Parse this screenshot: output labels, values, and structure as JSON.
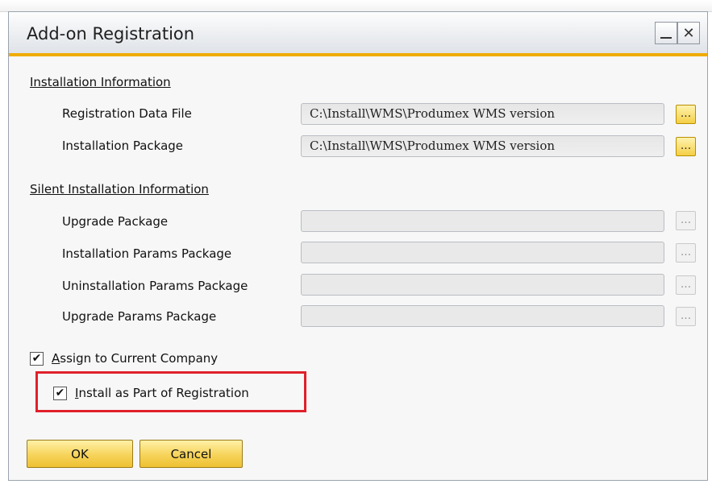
{
  "window": {
    "title": "Add-on Registration",
    "minimize_glyph": "_",
    "close_glyph": "✕"
  },
  "installation_info": {
    "section_title": "Installation Information",
    "rows": [
      {
        "label": "Registration Data File",
        "value": "C:\\Install\\WMS\\Produmex WMS version",
        "browse": "..."
      },
      {
        "label": "Installation Package",
        "value": "C:\\Install\\WMS\\Produmex WMS version",
        "browse": "..."
      }
    ]
  },
  "silent_installation": {
    "section_title": "Silent Installation Information",
    "rows": [
      {
        "label": "Upgrade Package",
        "value": "",
        "browse": "..."
      },
      {
        "label": "Installation Params Package",
        "value": "",
        "browse": "..."
      },
      {
        "label": "Uninstallation Params Package",
        "value": "",
        "browse": "..."
      },
      {
        "label": "Upgrade Params Package",
        "value": "",
        "browse": "..."
      }
    ]
  },
  "options": {
    "assign_to_company": {
      "label_hotkey": "A",
      "label_rest": "ssign to Current Company",
      "checked": true,
      "mark": "✔"
    },
    "install_as_part": {
      "label_hotkey": "I",
      "label_rest": "nstall as Part of Registration",
      "checked": true,
      "mark": "✔"
    }
  },
  "buttons": {
    "ok": "OK",
    "cancel": "Cancel"
  },
  "colors": {
    "accent": "#f0ab00",
    "highlight_border": "#e0202a",
    "button_yellow": "#f6d35a"
  }
}
